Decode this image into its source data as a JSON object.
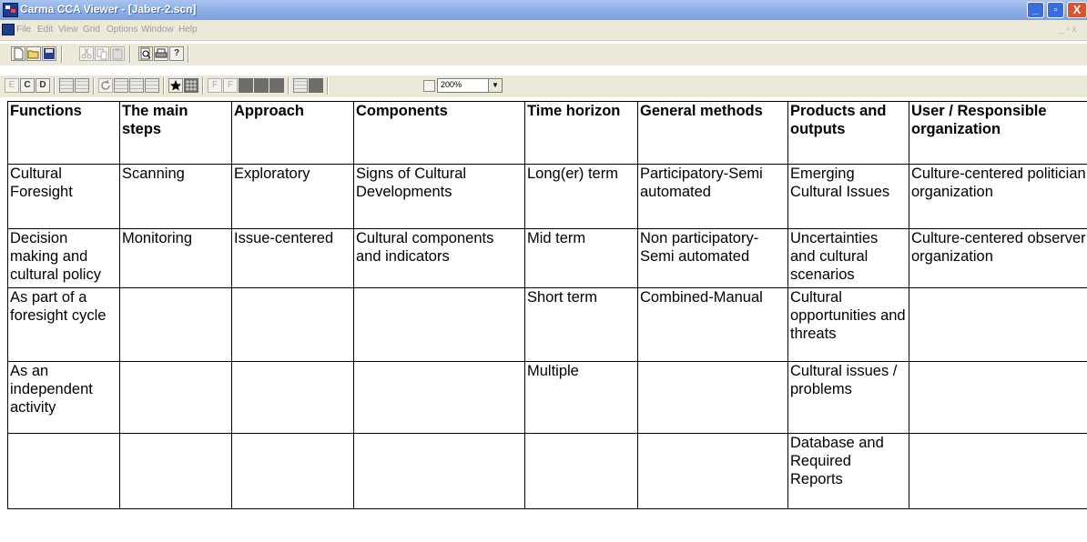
{
  "window": {
    "title": "Carma CCA Viewer - [Jaber-2.scn]",
    "minimize_glyph": "_",
    "maximize_glyph": "▫",
    "close_glyph": "X"
  },
  "menu": {
    "items": [
      "File",
      "Edit",
      "View",
      "Grid",
      "Options",
      "Window",
      "Help"
    ],
    "mdi_controls": "_ ▫ x"
  },
  "toolbar": {
    "top_buttons": [
      "new-icon",
      "open-icon",
      "save-icon",
      "cut-icon",
      "copy-icon",
      "paste-icon",
      "print-preview-icon",
      "print-icon",
      "help-icon"
    ],
    "help_glyph": "?",
    "view_buttons": [
      "E",
      "C",
      "D"
    ],
    "font_buttons": [
      "F",
      "F"
    ],
    "zoom_value": "200%",
    "zoom_arrow": "▼"
  },
  "grid": {
    "columns": [
      "Functions",
      "The main steps",
      "Approach",
      "Components",
      "Time horizon",
      "General methods",
      "Products and outputs",
      "User /  Responsible organization"
    ],
    "rows": [
      [
        "Cultural Foresight",
        "Scanning",
        "Exploratory",
        "Signs of Cultural Developments",
        "Long(er) term",
        "Participatory-Semi automated",
        "Emerging Cultural Issues",
        "Culture-centered politician organization"
      ],
      [
        "Decision making and cultural policy",
        "Monitoring",
        "Issue-centered",
        "Cultural components and indicators",
        "Mid term",
        " Non participatory-Semi automated",
        "Uncertainties and cultural scenarios",
        "Culture-centered observer organization"
      ],
      [
        "As part of a foresight cycle",
        "",
        "",
        "",
        "Short term",
        "Combined-Manual",
        " Cultural opportunities and  threats",
        ""
      ],
      [
        "As an independent activity",
        "",
        "",
        "",
        "Multiple",
        "",
        "Cultural issues / problems",
        ""
      ],
      [
        "",
        "",
        "",
        "",
        "",
        "",
        "Database and Required Reports",
        ""
      ]
    ]
  }
}
